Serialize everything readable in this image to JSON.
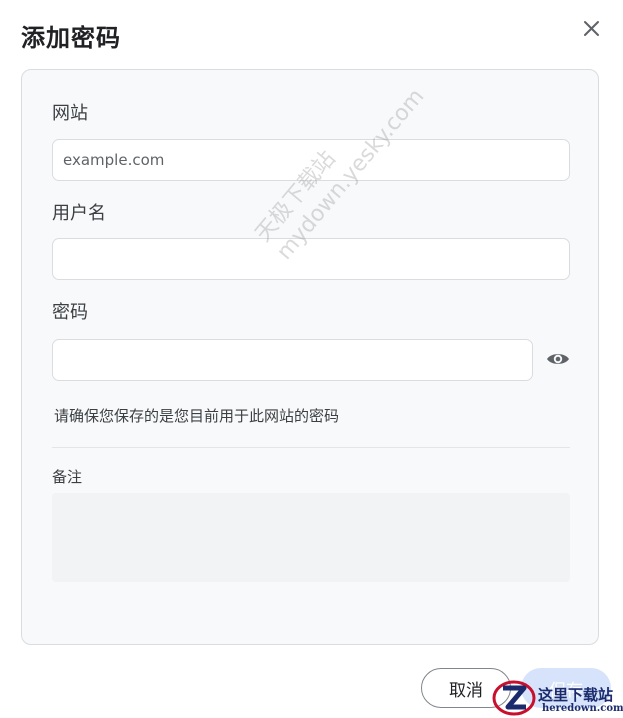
{
  "dialog": {
    "title": "添加密码",
    "close_icon": "close-icon"
  },
  "form": {
    "site_label": "网站",
    "site_placeholder": "example.com",
    "site_value": "",
    "username_label": "用户名",
    "username_value": "",
    "password_label": "密码",
    "password_value": "",
    "show_password_icon": "eye-icon",
    "hint": "请确保您保存的是您目前用于此网站的密码",
    "notes_label": "备注",
    "notes_value": ""
  },
  "watermark": {
    "line1": "天极下载站",
    "line2": "mydown.yesky.com"
  },
  "footer": {
    "cancel_label": "取消",
    "save_label": "保存"
  },
  "corner_logo": {
    "title": "这里下载站",
    "subtitle": "heredown.com"
  },
  "colors": {
    "panel_background": "#f8f9fa",
    "save_button_disabled": "#d6e3fb",
    "logo_blue": "#1a2a6c",
    "logo_red": "#c8102e"
  }
}
